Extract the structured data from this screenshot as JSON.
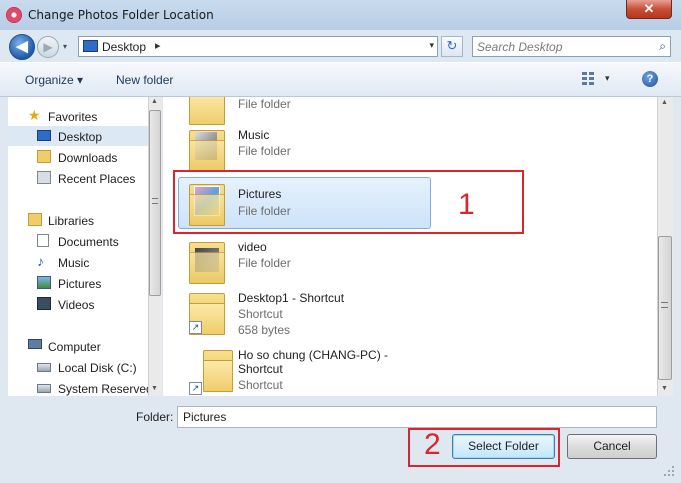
{
  "window": {
    "title": "Change Photos Folder Location",
    "close_label": "✕"
  },
  "nav": {
    "back_glyph": "◀",
    "forward_glyph": "▶",
    "history_glyph": "▾",
    "refresh_glyph": "↻"
  },
  "address": {
    "location": "Desktop",
    "chevron": "▸",
    "dropdown": "▾"
  },
  "search": {
    "placeholder": "Search Desktop",
    "icon": "⌕"
  },
  "toolbar": {
    "organize": "Organize ▾",
    "new_folder": "New folder",
    "view_dropdown": "▾",
    "help": "?"
  },
  "sidebar": {
    "favorites": {
      "label": "Favorites",
      "items": [
        {
          "label": "Desktop"
        },
        {
          "label": "Downloads"
        },
        {
          "label": "Recent Places"
        }
      ]
    },
    "libraries": {
      "label": "Libraries",
      "items": [
        {
          "label": "Documents"
        },
        {
          "label": "Music"
        },
        {
          "label": "Pictures"
        },
        {
          "label": "Videos"
        }
      ]
    },
    "computer": {
      "label": "Computer",
      "items": [
        {
          "label": "Local Disk (C:)"
        },
        {
          "label": "System Reserved"
        }
      ]
    }
  },
  "files": [
    {
      "name": "",
      "type": "File folder"
    },
    {
      "name": "Music",
      "type": "File folder"
    },
    {
      "name": "Pictures",
      "type": "File folder"
    },
    {
      "name": "video",
      "type": "File folder"
    },
    {
      "name": "Desktop1 - Shortcut",
      "type": "Shortcut",
      "size": "658 bytes"
    },
    {
      "name": "Ho so chung (CHANG-PC) -",
      "name2": "Shortcut",
      "type": "Shortcut"
    }
  ],
  "footer": {
    "folder_label": "Folder:",
    "folder_value": "Pictures",
    "select_button": "Select Folder",
    "cancel_button": "Cancel"
  },
  "annotations": {
    "first": "1",
    "second": "2"
  },
  "colors": {
    "annotation": "#d9252b",
    "selection": "#cde3f9",
    "accent": "#1f5aa8"
  }
}
